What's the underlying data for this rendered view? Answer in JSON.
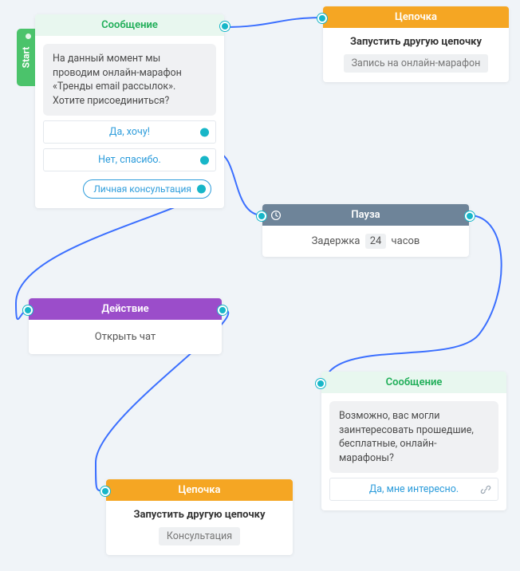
{
  "start_label": "Start",
  "node1": {
    "header": "Сообщение",
    "bubble": "На данный момент мы проводим онлайн-марафон «Тренды email рассылок». Хотите присоединиться?",
    "opt1": "Да, хочу!",
    "opt2": "Нет, спасибо.",
    "pill": "Личная консультация"
  },
  "node2": {
    "header": "Цепочка",
    "title": "Запустить другую цепочку",
    "sub": "Запись на онлайн-марафон"
  },
  "node3": {
    "header": "Пауза",
    "prefix": "Задержка",
    "value": "24",
    "suffix": "часов"
  },
  "node4": {
    "header": "Действие",
    "text": "Открыть чат"
  },
  "node5": {
    "header": "Сообщение",
    "bubble": "Возможно, вас могли заинтересовать прошедшие, бесплатные, онлайн-марафоны?",
    "opt1": "Да, мне интересно."
  },
  "node6": {
    "header": "Цепочка",
    "title": "Запустить другую цепочку",
    "sub": "Консультация"
  }
}
